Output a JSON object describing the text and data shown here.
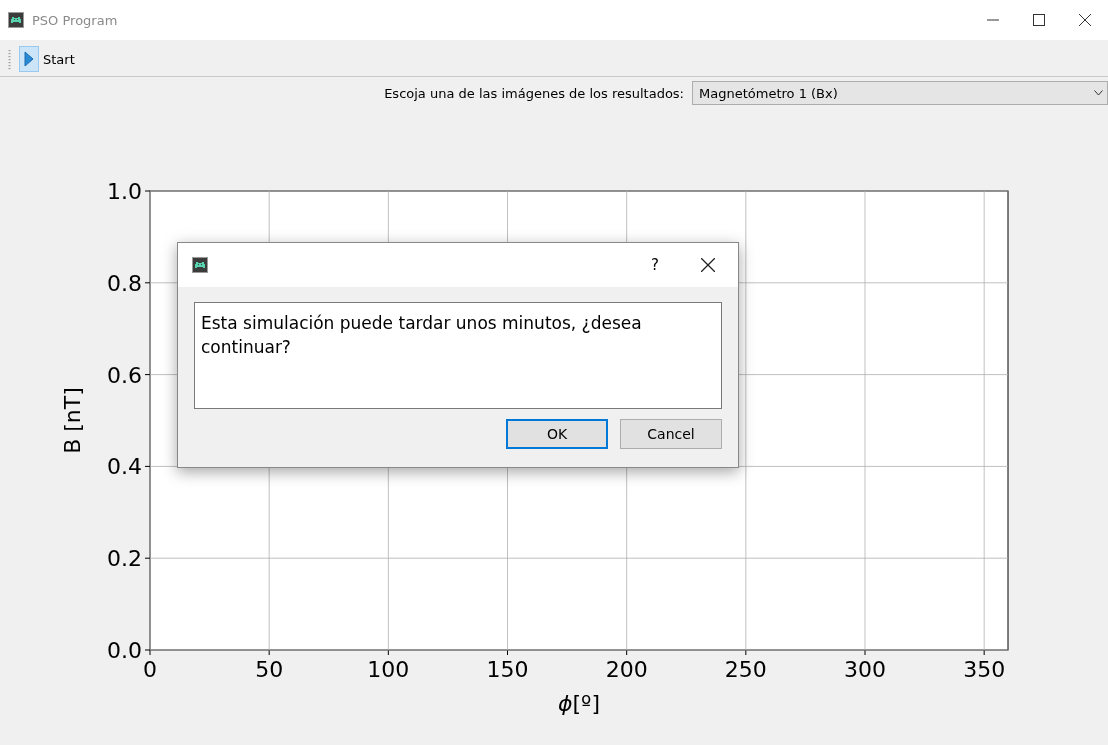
{
  "window": {
    "title": "PSO Program"
  },
  "toolbar": {
    "items": [
      {
        "label": "Start",
        "selected": true
      }
    ]
  },
  "selector": {
    "label": "Escoja una de las imágenes de los resultados:",
    "value": "Magnetómetro 1 (Bx)"
  },
  "plot": {
    "chart_data": {
      "type": "line",
      "xlabel": "*ϕ*[º]",
      "ylabel": "B [nT]",
      "xlim": [
        0,
        360
      ],
      "ylim": [
        0,
        1
      ],
      "xticks": [
        {
          "value": 0,
          "label": "0"
        },
        {
          "value": 50,
          "label": "50"
        },
        {
          "value": 100,
          "label": "100"
        },
        {
          "value": 150,
          "label": "150"
        },
        {
          "value": 200,
          "label": "200"
        },
        {
          "value": 250,
          "label": "250"
        },
        {
          "value": 300,
          "label": "300"
        },
        {
          "value": 350,
          "label": "350"
        }
      ],
      "yticks": [
        {
          "value": 0,
          "label": "0.0"
        },
        {
          "value": 0.2,
          "label": "0.2"
        },
        {
          "value": 0.4,
          "label": "0.4"
        },
        {
          "value": 0.6,
          "label": "0.6"
        },
        {
          "value": 0.8,
          "label": "0.8"
        },
        {
          "value": 1,
          "label": "1.0"
        }
      ],
      "grid": true
    }
  },
  "dialog": {
    "help": "?",
    "message": "Esta simulación puede tardar unos minutos, ¿desea continuar?",
    "buttons": [
      {
        "label": "OK",
        "selected": true
      },
      {
        "label": "Cancel",
        "selected": false
      }
    ]
  }
}
